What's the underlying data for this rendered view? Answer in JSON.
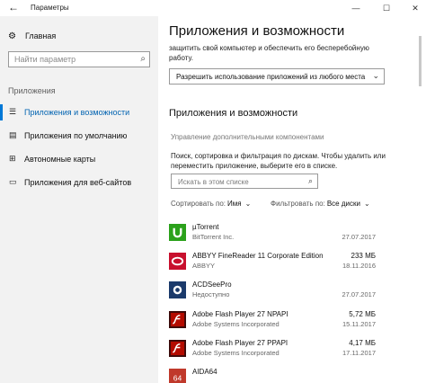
{
  "window": {
    "title": "Параметры",
    "back_icon": "back-arrow-icon",
    "minimize_icon": "minimize-icon",
    "maximize_icon": "maximize-icon",
    "close_icon": "close-icon"
  },
  "sidebar": {
    "home_label": "Главная",
    "search_placeholder": "Найти параметр",
    "section_label": "Приложения",
    "items": [
      {
        "label": "Приложения и возможности",
        "icon": "apps-list-icon",
        "active": true
      },
      {
        "label": "Приложения по умолчанию",
        "icon": "default-apps-icon",
        "active": false
      },
      {
        "label": "Автономные карты",
        "icon": "map-icon",
        "active": false
      },
      {
        "label": "Приложения для веб-сайтов",
        "icon": "web-apps-icon",
        "active": false
      }
    ]
  },
  "main": {
    "title": "Приложения и возможности",
    "description_line1": "защитить свой компьютер и обеспечить его бесперебойную",
    "description_line2": "работу.",
    "install_dropdown_value": "Разрешить использование приложений из любого места",
    "section_title": "Приложения и возможности",
    "manage_link": "Управление дополнительными компонентами",
    "search_description_line1": "Поиск, сортировка и фильтрация по дискам. Чтобы удалить или",
    "search_description_line2": "переместить приложение, выберите его в списке.",
    "list_search_placeholder": "Искать в этом списке",
    "sort_label": "Сортировать по:",
    "sort_value": "Имя",
    "filter_label": "Фильтровать по:",
    "filter_value": "Все диски",
    "apps": [
      {
        "name": "µTorrent",
        "publisher": "BitTorrent Inc.",
        "size": "",
        "date": "27.07.2017",
        "icon": "utorrent-icon",
        "color": "#2ba11b"
      },
      {
        "name": "ABBYY FineReader 11 Corporate Edition",
        "publisher": "ABBYY",
        "size": "233 МБ",
        "date": "18.11.2016",
        "icon": "abbyy-icon",
        "color": "#c8102e"
      },
      {
        "name": "ACDSeePro",
        "publisher": "Недоступно",
        "size": "",
        "date": "27.07.2017",
        "icon": "acdsee-icon",
        "color": "#1b3a6b"
      },
      {
        "name": "Adobe Flash Player 27 NPAPI",
        "publisher": "Adobe Systems Incorporated",
        "size": "5,72 МБ",
        "date": "15.11.2017",
        "icon": "flash-icon",
        "color": "#b30b00"
      },
      {
        "name": "Adobe Flash Player 27 PPAPI",
        "publisher": "Adobe Systems Incorporated",
        "size": "4,17 МБ",
        "date": "17.11.2017",
        "icon": "flash-icon",
        "color": "#b30b00"
      },
      {
        "name": "AIDA64",
        "publisher": "",
        "size": "",
        "date": "",
        "icon": "aida64-icon",
        "color": "#c0392b"
      }
    ]
  }
}
